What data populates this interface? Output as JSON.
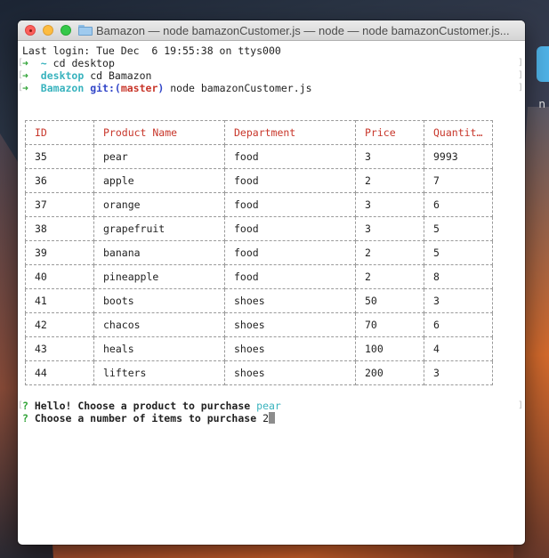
{
  "window": {
    "title": "Bamazon — node bamazonCustomer.js — node — node bamazonCustomer.js..."
  },
  "terminal": {
    "last_login": "Last login: Tue Dec  6 19:55:38 on ttys000",
    "lines": [
      {
        "arrow": "➜",
        "dir": "~",
        "command": "cd desktop"
      },
      {
        "arrow": "➜",
        "dir": "desktop",
        "command": "cd Bamazon"
      },
      {
        "arrow": "➜",
        "dir": "Bamazon",
        "git": "git:(",
        "branch": "master",
        "git_close": ")",
        "command": "node bamazonCustomer.js"
      }
    ]
  },
  "table": {
    "headers": [
      "ID",
      "Product Name",
      "Department",
      "Price",
      "Quantit…"
    ],
    "rows": [
      [
        "35",
        "pear",
        "food",
        "3",
        "9993"
      ],
      [
        "36",
        "apple",
        "food",
        "2",
        "7"
      ],
      [
        "37",
        "orange",
        "food",
        "3",
        "6"
      ],
      [
        "38",
        "grapefruit",
        "food",
        "3",
        "5"
      ],
      [
        "39",
        "banana",
        "food",
        "2",
        "5"
      ],
      [
        "40",
        "pineapple",
        "food",
        "2",
        "8"
      ],
      [
        "41",
        "boots",
        "shoes",
        "50",
        "3"
      ],
      [
        "42",
        "chacos",
        "shoes",
        "70",
        "6"
      ],
      [
        "43",
        "heals",
        "shoes",
        "100",
        "4"
      ],
      [
        "44",
        "lifters",
        "shoes",
        "200",
        "3"
      ]
    ]
  },
  "prompts": {
    "q1_mark": "?",
    "q1_text": "Hello! Choose a product to purchase",
    "q1_answer": "pear",
    "q2_mark": "?",
    "q2_text": "Choose a number of items to purchase",
    "q2_input": "2"
  },
  "desktop": {
    "partial_label": "n"
  },
  "colors": {
    "prompt_arrow": "#2fa336",
    "directory": "#39b3be",
    "git": "#3246c8",
    "branch": "#c8362a",
    "table_header": "#c8362a"
  }
}
